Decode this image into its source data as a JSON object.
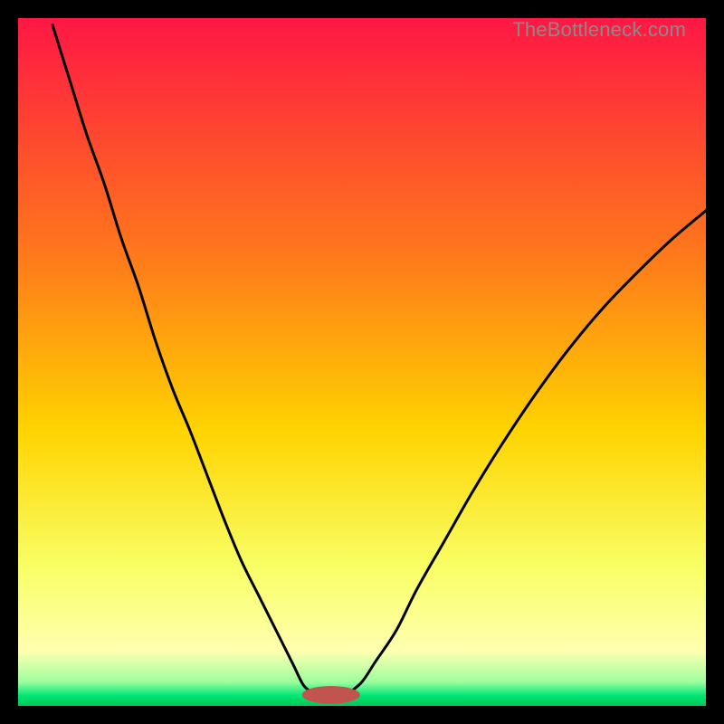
{
  "watermark": "TheBottleneck.com",
  "chart_data": {
    "type": "line",
    "title": "",
    "xlabel": "",
    "ylabel": "",
    "xlim": [
      0,
      100
    ],
    "ylim": [
      0,
      100
    ],
    "gradient_stops": [
      {
        "offset": 0.0,
        "color": "#ff1744"
      },
      {
        "offset": 0.35,
        "color": "#ff7a1a"
      },
      {
        "offset": 0.6,
        "color": "#ffd400"
      },
      {
        "offset": 0.8,
        "color": "#f8ff66"
      },
      {
        "offset": 0.92,
        "color": "#ffffb0"
      },
      {
        "offset": 0.965,
        "color": "#9dff9d"
      },
      {
        "offset": 0.985,
        "color": "#00e676"
      },
      {
        "offset": 1.0,
        "color": "#00c853"
      }
    ],
    "series": [
      {
        "name": "left-curve",
        "x": [
          5.0,
          7.5,
          10.0,
          12.5,
          15.0,
          17.5,
          20.0,
          22.5,
          25.0,
          27.5,
          30.0,
          32.5,
          35.0,
          37.5,
          40.0,
          41.5,
          43.0
        ],
        "y": [
          99.0,
          91.0,
          83.0,
          76.0,
          68.0,
          61.0,
          53.0,
          46.0,
          40.0,
          33.5,
          27.0,
          21.0,
          16.0,
          11.0,
          6.0,
          3.0,
          1.8
        ]
      },
      {
        "name": "right-curve",
        "x": [
          48.0,
          50.0,
          52.0,
          55.0,
          58.0,
          62.0,
          66.0,
          70.0,
          75.0,
          80.0,
          85.0,
          90.0,
          95.0,
          100.0
        ],
        "y": [
          1.8,
          3.5,
          6.5,
          11.0,
          17.0,
          24.0,
          31.0,
          37.5,
          45.0,
          51.8,
          57.8,
          63.0,
          67.8,
          72.0
        ]
      }
    ],
    "marker": {
      "name": "bottleneck-marker",
      "cx": 45.5,
      "cy": 1.6,
      "rx": 4.2,
      "ry": 1.3,
      "fill": "#c1554d"
    }
  }
}
